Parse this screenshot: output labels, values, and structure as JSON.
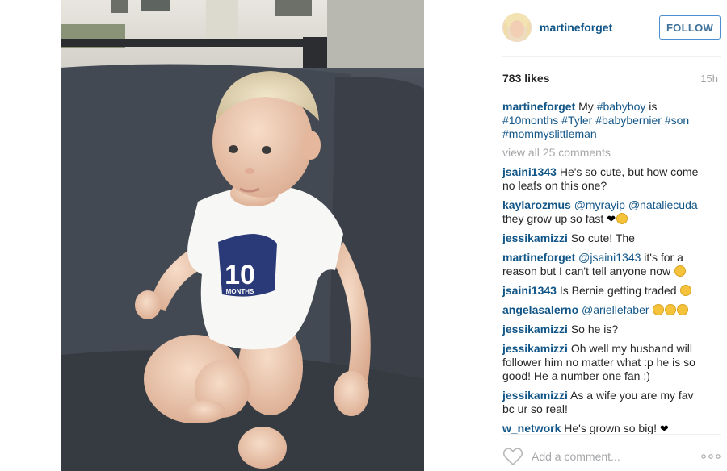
{
  "photo": {
    "alt_subject": "baby-photo",
    "shirt_number": "10",
    "shirt_text": "MONTHS"
  },
  "header": {
    "username": "martineforget",
    "follow_label": "FOLLOW"
  },
  "stats": {
    "likes": "783 likes",
    "time": "15h"
  },
  "caption": {
    "user": "martineforget",
    "text_pre": " My ",
    "tags": [
      "#babyboy",
      "#10months",
      "#Tyler",
      "#babybernier",
      "#son",
      "#mommyslittleman"
    ],
    "is_word": " is"
  },
  "view_all": "view all 25 comments",
  "comments": [
    {
      "user": "jsaini1343",
      "text": " He's so cute, but how come no leafs on this one?"
    },
    {
      "user": "kaylarozmus",
      "mentions": "@myrayip @nataliecuda",
      "text": " they grow up so fast"
    },
    {
      "user": "jessikamizzi",
      "text": " So cute! The"
    },
    {
      "user": "martineforget",
      "mentions": "@jsaini1343",
      "text": " it's for a reason but I can't tell anyone now"
    },
    {
      "user": "jsaini1343",
      "text": " Is Bernie getting traded"
    },
    {
      "user": "angelasalerno",
      "mentions": "@ariellefaber",
      "text": ""
    },
    {
      "user": "jessikamizzi",
      "text": " So he is?"
    },
    {
      "user": "jessikamizzi",
      "text": " Oh well my husband will follower him no matter what :p he is so good! He a number one fan :)"
    },
    {
      "user": "jessikamizzi",
      "text": " As a wife you are my fav bc ur so real!"
    },
    {
      "user": "w_network",
      "text": " He's grown so big!"
    }
  ],
  "add_comment": {
    "placeholder": "Add a comment..."
  },
  "icons": {
    "like": "heart-outline-icon",
    "more": "more-options-icon"
  },
  "colors": {
    "link": "#125688",
    "muted": "#a5a7aa",
    "follow_border": "#4a8fd0"
  }
}
